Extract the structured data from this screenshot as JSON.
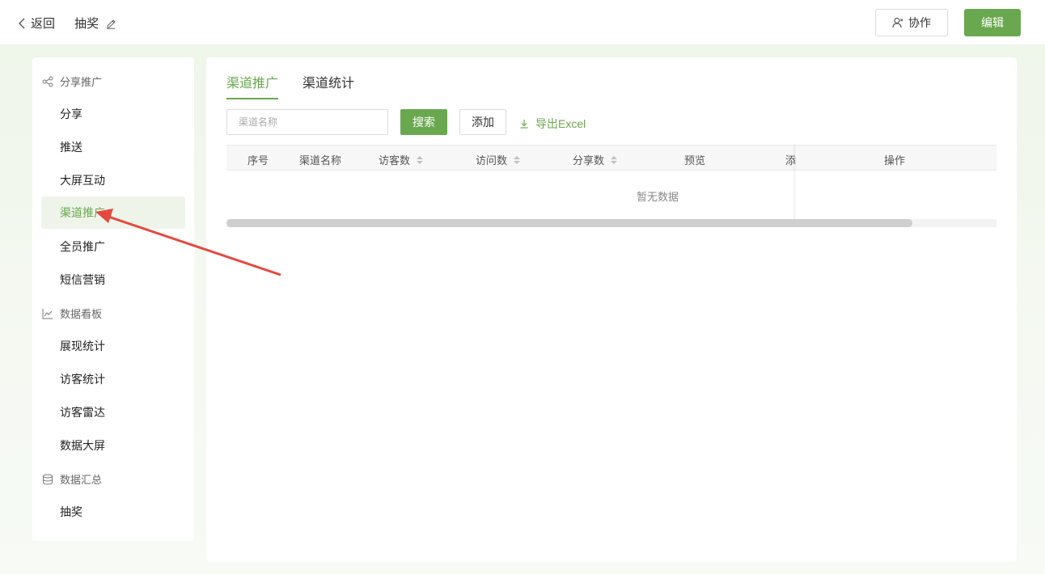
{
  "header": {
    "back_label": "返回",
    "title": "抽奖",
    "collab_label": "协作",
    "edit_label": "编辑"
  },
  "sidebar": {
    "groups": [
      {
        "title": "分享推广",
        "icon": "share-icon",
        "items": [
          "分享",
          "推送",
          "大屏互动",
          "渠道推广",
          "全员推广",
          "短信营销"
        ]
      },
      {
        "title": "数据看板",
        "icon": "line-chart-icon",
        "items": [
          "展现统计",
          "访客统计",
          "访客雷达",
          "数据大屏"
        ]
      },
      {
        "title": "数据汇总",
        "icon": "database-icon",
        "items": [
          "抽奖"
        ]
      }
    ],
    "active_item": "渠道推广"
  },
  "main": {
    "tabs": [
      {
        "label": "渠道推广",
        "active": true
      },
      {
        "label": "渠道统计",
        "active": false
      }
    ],
    "search": {
      "placeholder": "渠道名称",
      "value": ""
    },
    "search_button": "搜索",
    "add_button": "添加",
    "export_button": "导出Excel",
    "table": {
      "columns": [
        {
          "label": "序号",
          "sortable": false
        },
        {
          "label": "渠道名称",
          "sortable": false
        },
        {
          "label": "访客数",
          "sortable": true
        },
        {
          "label": "访问数",
          "sortable": true
        },
        {
          "label": "分享数",
          "sortable": true
        },
        {
          "label": "预览",
          "sortable": false
        },
        {
          "label": "添",
          "sortable": false
        },
        {
          "label": "操作",
          "sortable": false
        }
      ],
      "rows": [],
      "empty_text": "暂无数据"
    }
  },
  "colors": {
    "accent": "#6aa84f",
    "annotation_arrow": "#e5483f"
  }
}
